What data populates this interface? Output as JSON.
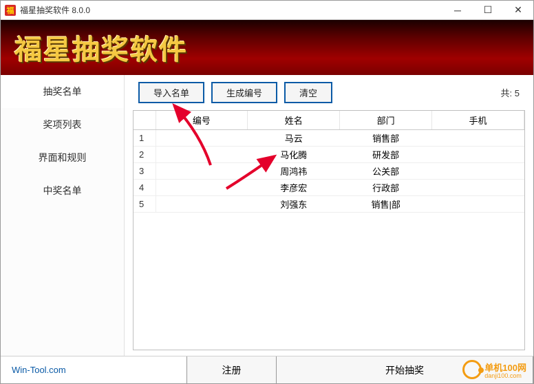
{
  "window": {
    "title": "福星抽奖软件 8.0.0",
    "icon_glyph": "福"
  },
  "banner": {
    "title": "福星抽奖软件"
  },
  "sidebar": {
    "items": [
      {
        "label": "抽奖名单",
        "active": true
      },
      {
        "label": "奖项列表",
        "active": false
      },
      {
        "label": "界面和规则",
        "active": false
      },
      {
        "label": "中奖名单",
        "active": false
      }
    ]
  },
  "toolbar": {
    "import_label": "导入名单",
    "generate_label": "生成编号",
    "clear_label": "清空",
    "count_prefix": "共:",
    "count_value": "5"
  },
  "table": {
    "columns": [
      "",
      "编号",
      "姓名",
      "部门",
      "手机"
    ],
    "rows": [
      {
        "n": "1",
        "id": "",
        "name": "马云",
        "dept": "销售部",
        "phone": ""
      },
      {
        "n": "2",
        "id": "",
        "name": "马化腾",
        "dept": "研发部",
        "phone": ""
      },
      {
        "n": "3",
        "id": "",
        "name": "周鸿祎",
        "dept": "公关部",
        "phone": ""
      },
      {
        "n": "4",
        "id": "",
        "name": "李彦宏",
        "dept": "行政部",
        "phone": ""
      },
      {
        "n": "5",
        "id": "",
        "name": "刘强东",
        "dept": "销售|部",
        "phone": ""
      }
    ]
  },
  "footer": {
    "link_text": "Win-Tool.com",
    "register_label": "注册",
    "start_label": "开始抽奖"
  },
  "watermark": {
    "text": "单机100网",
    "sub": "danji100.com"
  }
}
